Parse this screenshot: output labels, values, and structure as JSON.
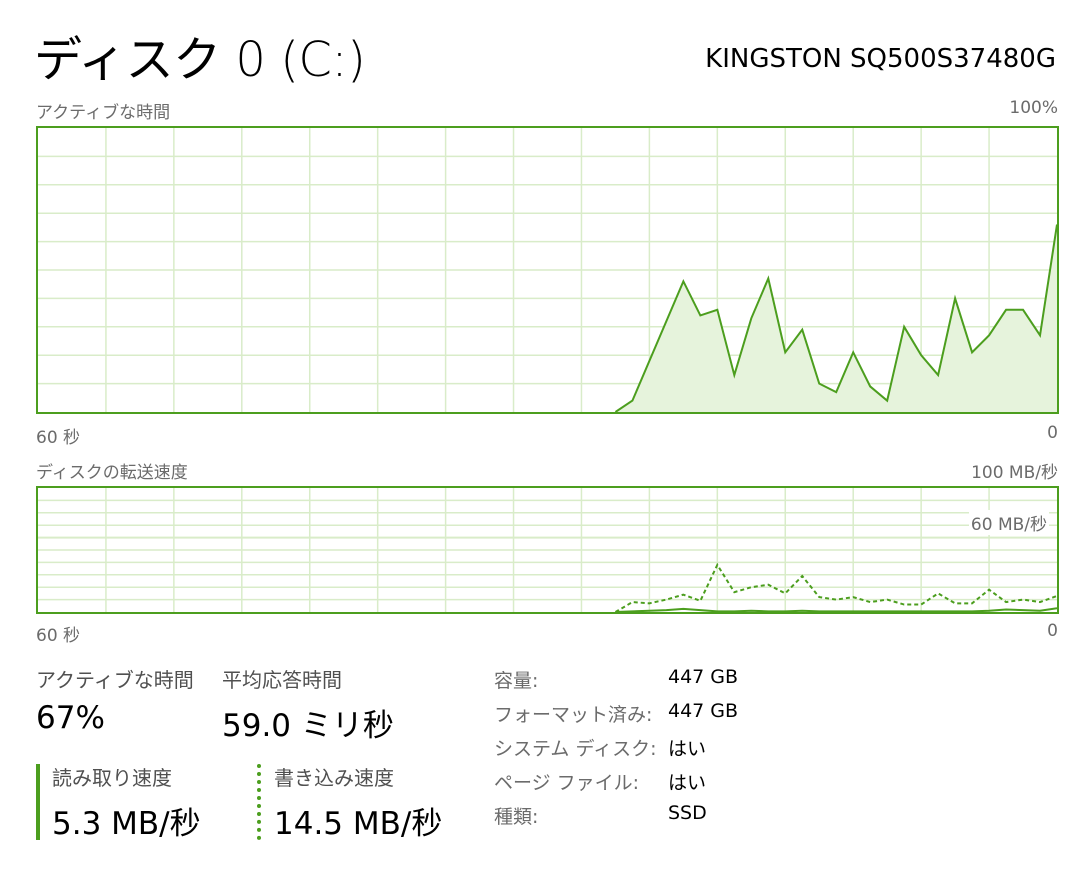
{
  "header": {
    "title": "ディスク 0 (C:)",
    "model": "KINGSTON SQ500S37480G"
  },
  "active_chart": {
    "label": "アクティブな時間",
    "max_label": "100%",
    "left_label": "60 秒",
    "right_label": "0"
  },
  "transfer_chart": {
    "label": "ディスクの転送速度",
    "max_label": "100 MB/秒",
    "ref_label": "60 MB/秒",
    "left_label": "60 秒",
    "right_label": "0"
  },
  "stats": {
    "active_time": {
      "label": "アクティブな時間",
      "value": "67%"
    },
    "avg_response": {
      "label": "平均応答時間",
      "value": "59.0 ミリ秒"
    },
    "read_speed": {
      "label": "読み取り速度",
      "value": "5.3 MB/秒"
    },
    "write_speed": {
      "label": "書き込み速度",
      "value": "14.5 MB/秒"
    }
  },
  "properties": [
    {
      "label": "容量:",
      "value": "447 GB"
    },
    {
      "label": "フォーマット済み:",
      "value": "447 GB"
    },
    {
      "label": "システム ディスク:",
      "value": "はい"
    },
    {
      "label": "ページ ファイル:",
      "value": "はい"
    },
    {
      "label": "種類:",
      "value": "SSD"
    }
  ],
  "colors": {
    "accent": "#4c9e1e",
    "grid": "#d9ecc9",
    "fill": "#e6f3dc"
  },
  "chart_data": [
    {
      "type": "area",
      "title": "アクティブな時間",
      "xlabel": "",
      "ylabel": "",
      "xlim": [
        60,
        0
      ],
      "ylim": [
        0,
        100
      ],
      "grid": true,
      "series": [
        {
          "x": [
            26,
            25,
            24,
            23,
            22,
            21,
            20,
            19,
            18,
            17,
            16,
            15,
            14,
            13,
            12,
            11,
            10,
            9,
            8,
            7,
            6,
            5,
            4,
            3,
            2,
            1,
            0
          ],
          "values": [
            0,
            4,
            18,
            32,
            46,
            34,
            36,
            13,
            33,
            47,
            21,
            29,
            10,
            7,
            21,
            9,
            4,
            30,
            20,
            13,
            40,
            21,
            27,
            36,
            36,
            27,
            66
          ]
        }
      ]
    },
    {
      "type": "line",
      "title": "ディスクの転送速度",
      "xlabel": "",
      "ylabel": "",
      "xlim": [
        60,
        0
      ],
      "ylim": [
        0,
        100
      ],
      "grid": true,
      "series": [
        {
          "name": "読み取り速度",
          "style": "solid",
          "x": [
            26,
            25,
            24,
            23,
            22,
            21,
            20,
            19,
            18,
            17,
            16,
            15,
            14,
            13,
            12,
            11,
            10,
            9,
            8,
            7,
            6,
            5,
            4,
            3,
            2,
            1,
            0
          ],
          "values": [
            0,
            0.5,
            1,
            1.5,
            2.5,
            1.5,
            0.5,
            0.5,
            1,
            0.5,
            0.5,
            1,
            0.5,
            0.5,
            0.5,
            0.5,
            0.5,
            0.5,
            0.5,
            0.5,
            0.5,
            0.5,
            1,
            2,
            1.5,
            1,
            3
          ]
        },
        {
          "name": "書き込み速度",
          "style": "dashed",
          "x": [
            26,
            25,
            24,
            23,
            22,
            21,
            20,
            19,
            18,
            17,
            16,
            15,
            14,
            13,
            12,
            11,
            10,
            9,
            8,
            7,
            6,
            5,
            4,
            3,
            2,
            1,
            0
          ],
          "values": [
            0,
            8,
            7,
            10,
            14,
            9,
            38,
            16,
            20,
            22,
            15,
            29,
            12,
            10,
            12,
            8,
            10,
            6,
            6,
            15,
            7,
            7,
            18,
            8,
            10,
            8,
            13
          ]
        }
      ]
    }
  ]
}
